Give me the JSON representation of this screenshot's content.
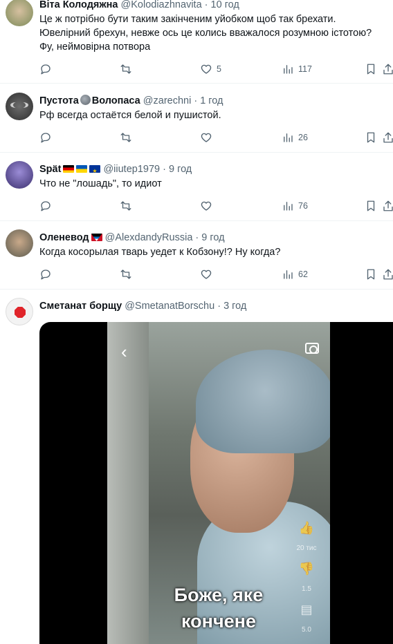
{
  "tweets": [
    {
      "name": "Віта Колодяжна",
      "handle": "@Kolodiazhnavita",
      "time": "10 год",
      "lines": [
        "Це ж потрібно бути таким закінченим уйобком щоб так брехати.",
        "Ювелірний брехун, невже ось це колись вважалося розумною істотою?",
        "Фу, неймовірна потвора"
      ],
      "likes": "5",
      "views": "117"
    },
    {
      "name_a": "Пустота",
      "name_b": "Волопаса",
      "handle": "@zarechni",
      "time": "1 год",
      "lines": [
        "Рф всегда остаётся белой и пушистой."
      ],
      "views": "26"
    },
    {
      "name": "Spät",
      "handle": "@iiutep1979",
      "time": "9 год",
      "lines": [
        "Что не \"лошадь\", то идиот"
      ],
      "views": "76"
    },
    {
      "name": "Оленевод",
      "handle": "@AlexdandyRussia",
      "time": "9 год",
      "lines": [
        "Когда косорылая тварь уедет к Кобзону!? Ну когда?"
      ],
      "views": "62"
    },
    {
      "name": "Сметанат борщу",
      "handle": "@SmetanatBorschu",
      "time": "3 год",
      "media": {
        "caption_1": "Боже, яке",
        "caption_2": "кончене",
        "side_1": "20 тис",
        "side_2": "1.5",
        "side_3": "5.0"
      }
    }
  ],
  "dot": "·",
  "icons": [
    "reply-icon",
    "retweet-icon",
    "like-icon",
    "views-icon",
    "bookmark-icon",
    "share-icon",
    "camera-icon",
    "back-icon"
  ]
}
